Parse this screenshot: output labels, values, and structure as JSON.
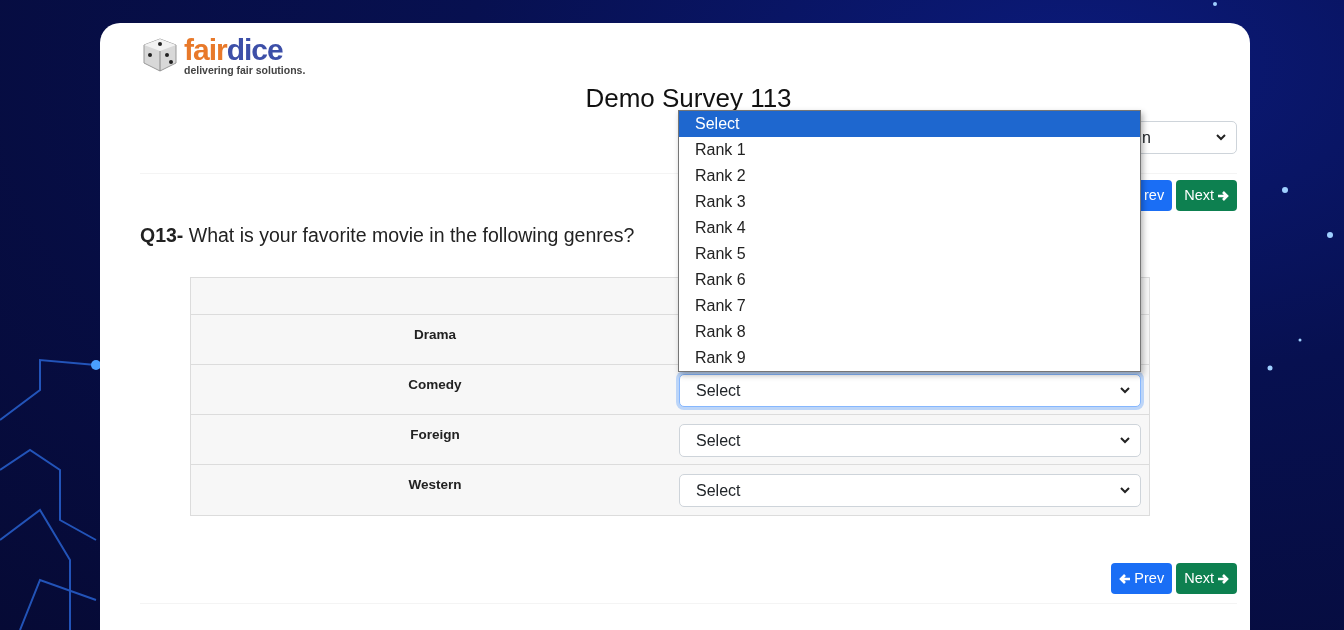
{
  "logo": {
    "word_start": "fair",
    "word_end": "dice",
    "tagline": "delivering fair solutions."
  },
  "title": "Demo Survey 113",
  "language_select": {
    "value": "n"
  },
  "top_nav": {
    "prev": "rev",
    "next": "Next"
  },
  "question": {
    "number": "Q13-",
    "text": "What is your favorite movie in the following genres?"
  },
  "rows": [
    {
      "label": "Drama",
      "focused": false
    },
    {
      "label": "Comedy",
      "value": "Select",
      "focused": true
    },
    {
      "label": "Foreign",
      "value": "Select",
      "focused": false
    },
    {
      "label": "Western",
      "value": "Select",
      "focused": false
    }
  ],
  "dropdown": {
    "options": [
      {
        "label": "Select",
        "selected": true
      },
      {
        "label": "Rank 1",
        "selected": false
      },
      {
        "label": "Rank 2",
        "selected": false
      },
      {
        "label": "Rank 3",
        "selected": false
      },
      {
        "label": "Rank 4",
        "selected": false
      },
      {
        "label": "Rank 5",
        "selected": false
      },
      {
        "label": "Rank 6",
        "selected": false
      },
      {
        "label": "Rank 7",
        "selected": false
      },
      {
        "label": "Rank 8",
        "selected": false
      },
      {
        "label": "Rank 9",
        "selected": false
      }
    ]
  },
  "bottom_nav": {
    "prev": "Prev",
    "next": "Next"
  }
}
